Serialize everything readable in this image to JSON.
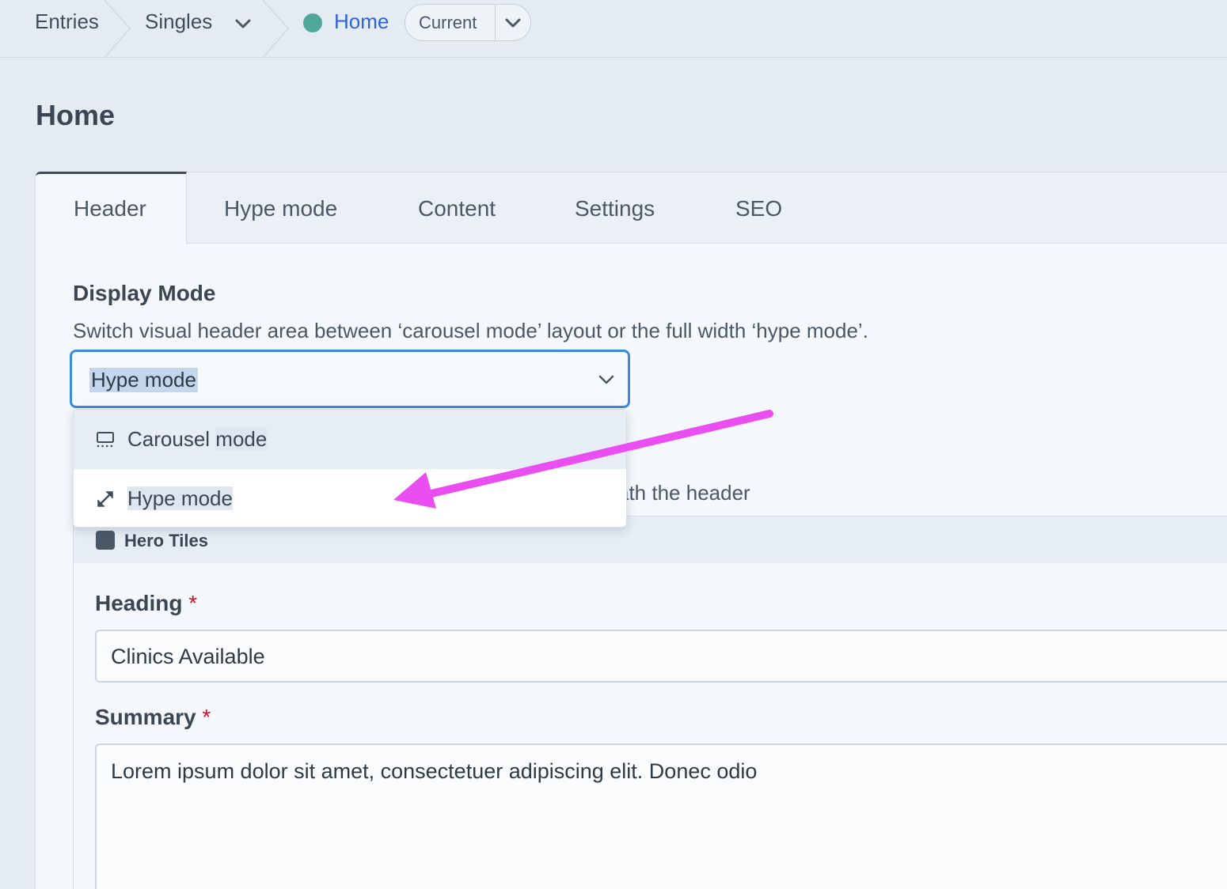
{
  "breadcrumb": {
    "entries": "Entries",
    "singles": "Singles",
    "current_entry": "Home",
    "revision": "Current"
  },
  "page_title": "Home",
  "tabs": [
    {
      "label": "Header",
      "active": true
    },
    {
      "label": "Hype mode",
      "active": false
    },
    {
      "label": "Content",
      "active": false
    },
    {
      "label": "Settings",
      "active": false
    },
    {
      "label": "SEO",
      "active": false
    }
  ],
  "display_mode": {
    "label": "Display Mode",
    "instructions": "Switch visual header area between ‘carousel mode’ layout or the full width ‘hype mode’.",
    "selected": "Hype mode",
    "options": [
      {
        "label_a": "Carousel ",
        "label_b": "mode",
        "icon": "carousel-icon"
      },
      {
        "label_a": "Hype ",
        "label_b": "mode",
        "icon": "expand-arrows-icon"
      }
    ]
  },
  "obscured_instruction_tail": "ath the header",
  "hero_tiles": {
    "title": "Hero Tiles",
    "heading_label": "Heading",
    "heading_required": "*",
    "heading_value": "Clinics Available",
    "summary_label": "Summary",
    "summary_required": "*",
    "summary_value": "Lorem ipsum dolor sit amet, consectetuer adipiscing elit. Donec odio"
  },
  "colors": {
    "accent": "#2f63d8",
    "status_live": "#4fa89a",
    "focus_ring": "#3a8be0",
    "required": "#cf1124",
    "annotation_arrow": "#ea4ef0"
  }
}
